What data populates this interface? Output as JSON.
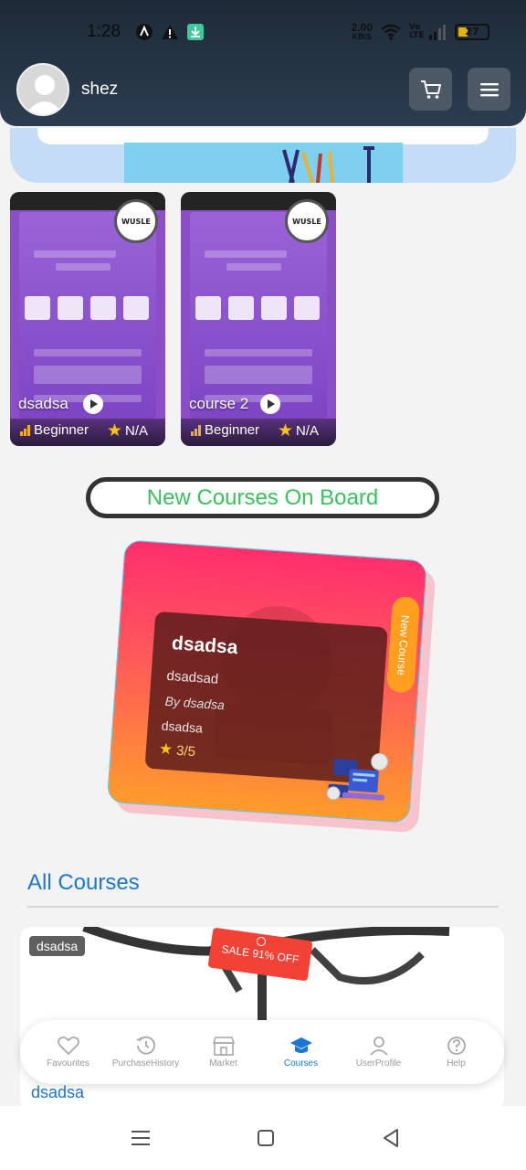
{
  "status_bar": {
    "time": "1:28",
    "net_speed_value": "2.00",
    "net_speed_unit": "KB/S",
    "network": "Vo LTE",
    "battery": "27"
  },
  "header": {
    "user_name": "shez",
    "cart_icon": "cart-icon",
    "menu_icon": "hamburger-menu-icon"
  },
  "featured_courses": [
    {
      "title": "dsadsa",
      "level": "Beginner",
      "rating": "N/A"
    },
    {
      "title": "course 2",
      "level": "Beginner",
      "rating": "N/A"
    }
  ],
  "new_courses": {
    "banner": "New Courses On Board",
    "card": {
      "title": "dsadsa",
      "description": "dsadsad",
      "author": "By dsadsa",
      "category": "dsadsa",
      "rating": "3/5",
      "ribbon": "New Course"
    }
  },
  "all_courses": {
    "title": "All Courses",
    "items": [
      {
        "category": "dsadsa",
        "sale": "SALE 91% OFF",
        "name": "dsadsa"
      }
    ]
  },
  "bottom_nav": {
    "items": [
      {
        "label": "Favourites",
        "icon": "heart-icon"
      },
      {
        "label": "PurchaseHistory",
        "icon": "history-icon"
      },
      {
        "label": "Market",
        "icon": "store-icon"
      },
      {
        "label": "Courses",
        "icon": "graduation-cap-icon",
        "active": true
      },
      {
        "label": "UserProfile",
        "icon": "user-icon"
      },
      {
        "label": "Help",
        "icon": "help-icon"
      }
    ]
  },
  "colors": {
    "accent": "#1b77d3",
    "header_bg": "#2c3d50",
    "new_courses_text": "#38c25e",
    "sale": "#f24236"
  }
}
